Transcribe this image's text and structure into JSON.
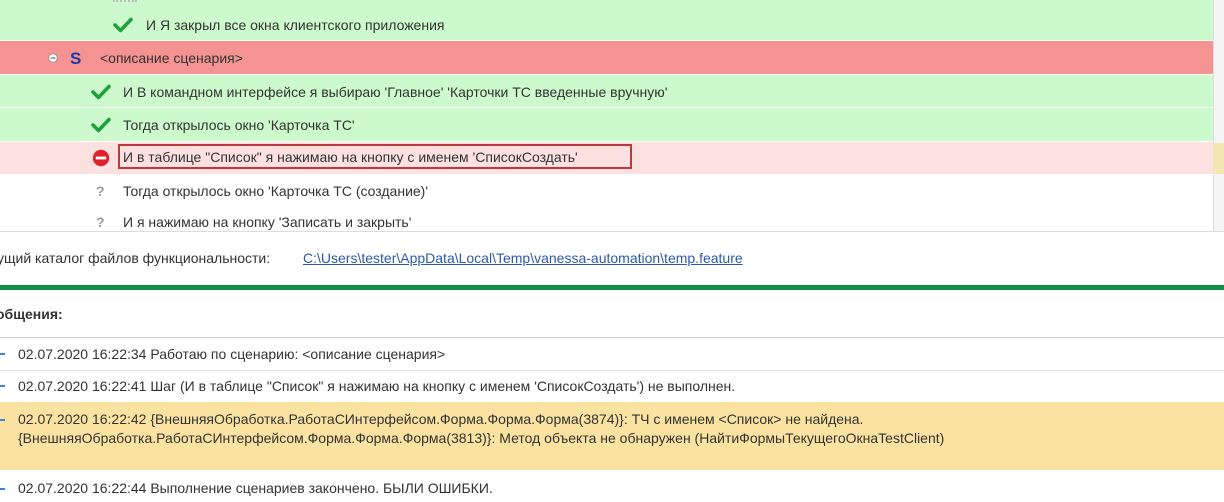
{
  "steps": [
    {
      "status": "passed",
      "text": "И Я закрыл все окна клиентского приложения"
    },
    {
      "status": "scenario",
      "marker": "S",
      "text": "<описание сценария>"
    },
    {
      "status": "passed",
      "text": "И В командном интерфейсе я выбираю 'Главное' 'Карточки ТС введенные вручную'"
    },
    {
      "status": "passed",
      "text": "Тогда открылось окно 'Карточка ТС'"
    },
    {
      "status": "failed",
      "text": "И в таблице \"Список\" я нажимаю на кнопку с именем 'СписокСоздать'"
    },
    {
      "status": "pending",
      "marker": "?",
      "text": "Тогда открылось окно 'Карточка ТС (создание)'"
    },
    {
      "status": "pending",
      "marker": "?",
      "text": "И я нажимаю на кнопку 'Записать и закрыть'"
    }
  ],
  "path": {
    "label": "ущий каталог файлов функциональности:",
    "link": "C:\\Users\\tester\\AppData\\Local\\Temp\\vanessa-automation\\temp.feature"
  },
  "messages": {
    "header": "общения:",
    "items": [
      {
        "lines": [
          "02.07.2020 16:22:34 Работаю по сценарию: <описание сценария>"
        ]
      },
      {
        "lines": [
          "02.07.2020 16:22:41 Шаг (И в таблице \"Список\" я нажимаю на кнопку с именем 'СписокСоздать') не выполнен."
        ]
      },
      {
        "lines": [
          "02.07.2020 16:22:42 {ВнешняяОбработка.РаботаСИнтерфейсом.Форма.Форма.Форма(3874)}: ТЧ с именем <Список> не найдена.",
          "{ВнешняяОбработка.РаботаСИнтерфейсом.Форма.Форма.Форма(3813)}: Метод объекта не обнаружен (НайтиФормыТекущегоОкнаTestClient)"
        ]
      },
      {
        "lines": [
          "02.07.2020 16:22:44 Выполнение сценариев закончено. БЫЛИ ОШИБКИ."
        ]
      }
    ]
  },
  "colors": {
    "passed_row": "#ccfacc",
    "scenario_row": "#f59292",
    "failed_row": "#fde1e1",
    "check_icon": "#1ea03a",
    "error_icon": "#e0212c",
    "scenario_marker": "#1f3aa6",
    "highlight_border": "#c0373b",
    "link": "#2c5aa8",
    "divider": "#0e8f44",
    "warning_message": "#fae3a0"
  },
  "icons": {
    "passed": "check-icon",
    "failed": "error-icon",
    "pending": "question-icon",
    "collapse": "collapse-minus-icon",
    "bullet": "message-bullet-icon"
  }
}
